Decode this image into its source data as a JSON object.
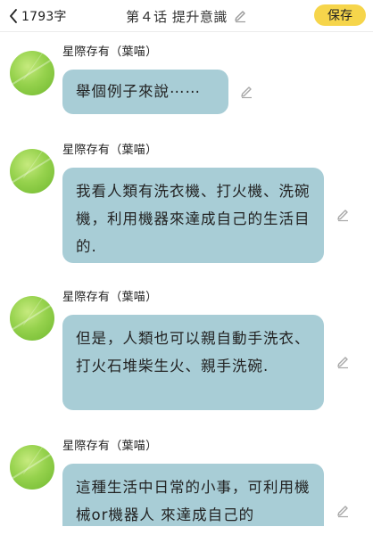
{
  "header": {
    "back_icon": "chevron-left-icon",
    "word_count": "1793字",
    "title": "第４话 提升意識",
    "title_edit_icon": "pencil-icon",
    "save_label": "保存",
    "save_color": "#f6d54b"
  },
  "colors": {
    "bubble": "#a8cdd6",
    "avatar": "#96d24d"
  },
  "messages": [
    {
      "sender": "星際存有（葉喵）",
      "text": "舉個例子來說⋯⋯",
      "edit_icon": "pencil-icon"
    },
    {
      "sender": "星際存有（葉喵）",
      "text": "我看人類有洗衣機、打火機、洗碗機，利用機器來達成自己的生活目的.",
      "edit_icon": "pencil-icon"
    },
    {
      "sender": "星際存有（葉喵）",
      "text": "但是，人類也可以親自動手洗衣、打火石堆柴生火、親手洗碗.",
      "edit_icon": "pencil-icon"
    },
    {
      "sender": "星際存有（葉喵）",
      "text": "這種生活中日常的小事，可利用機械or機器人 來達成自己的",
      "edit_icon": "pencil-icon"
    }
  ]
}
